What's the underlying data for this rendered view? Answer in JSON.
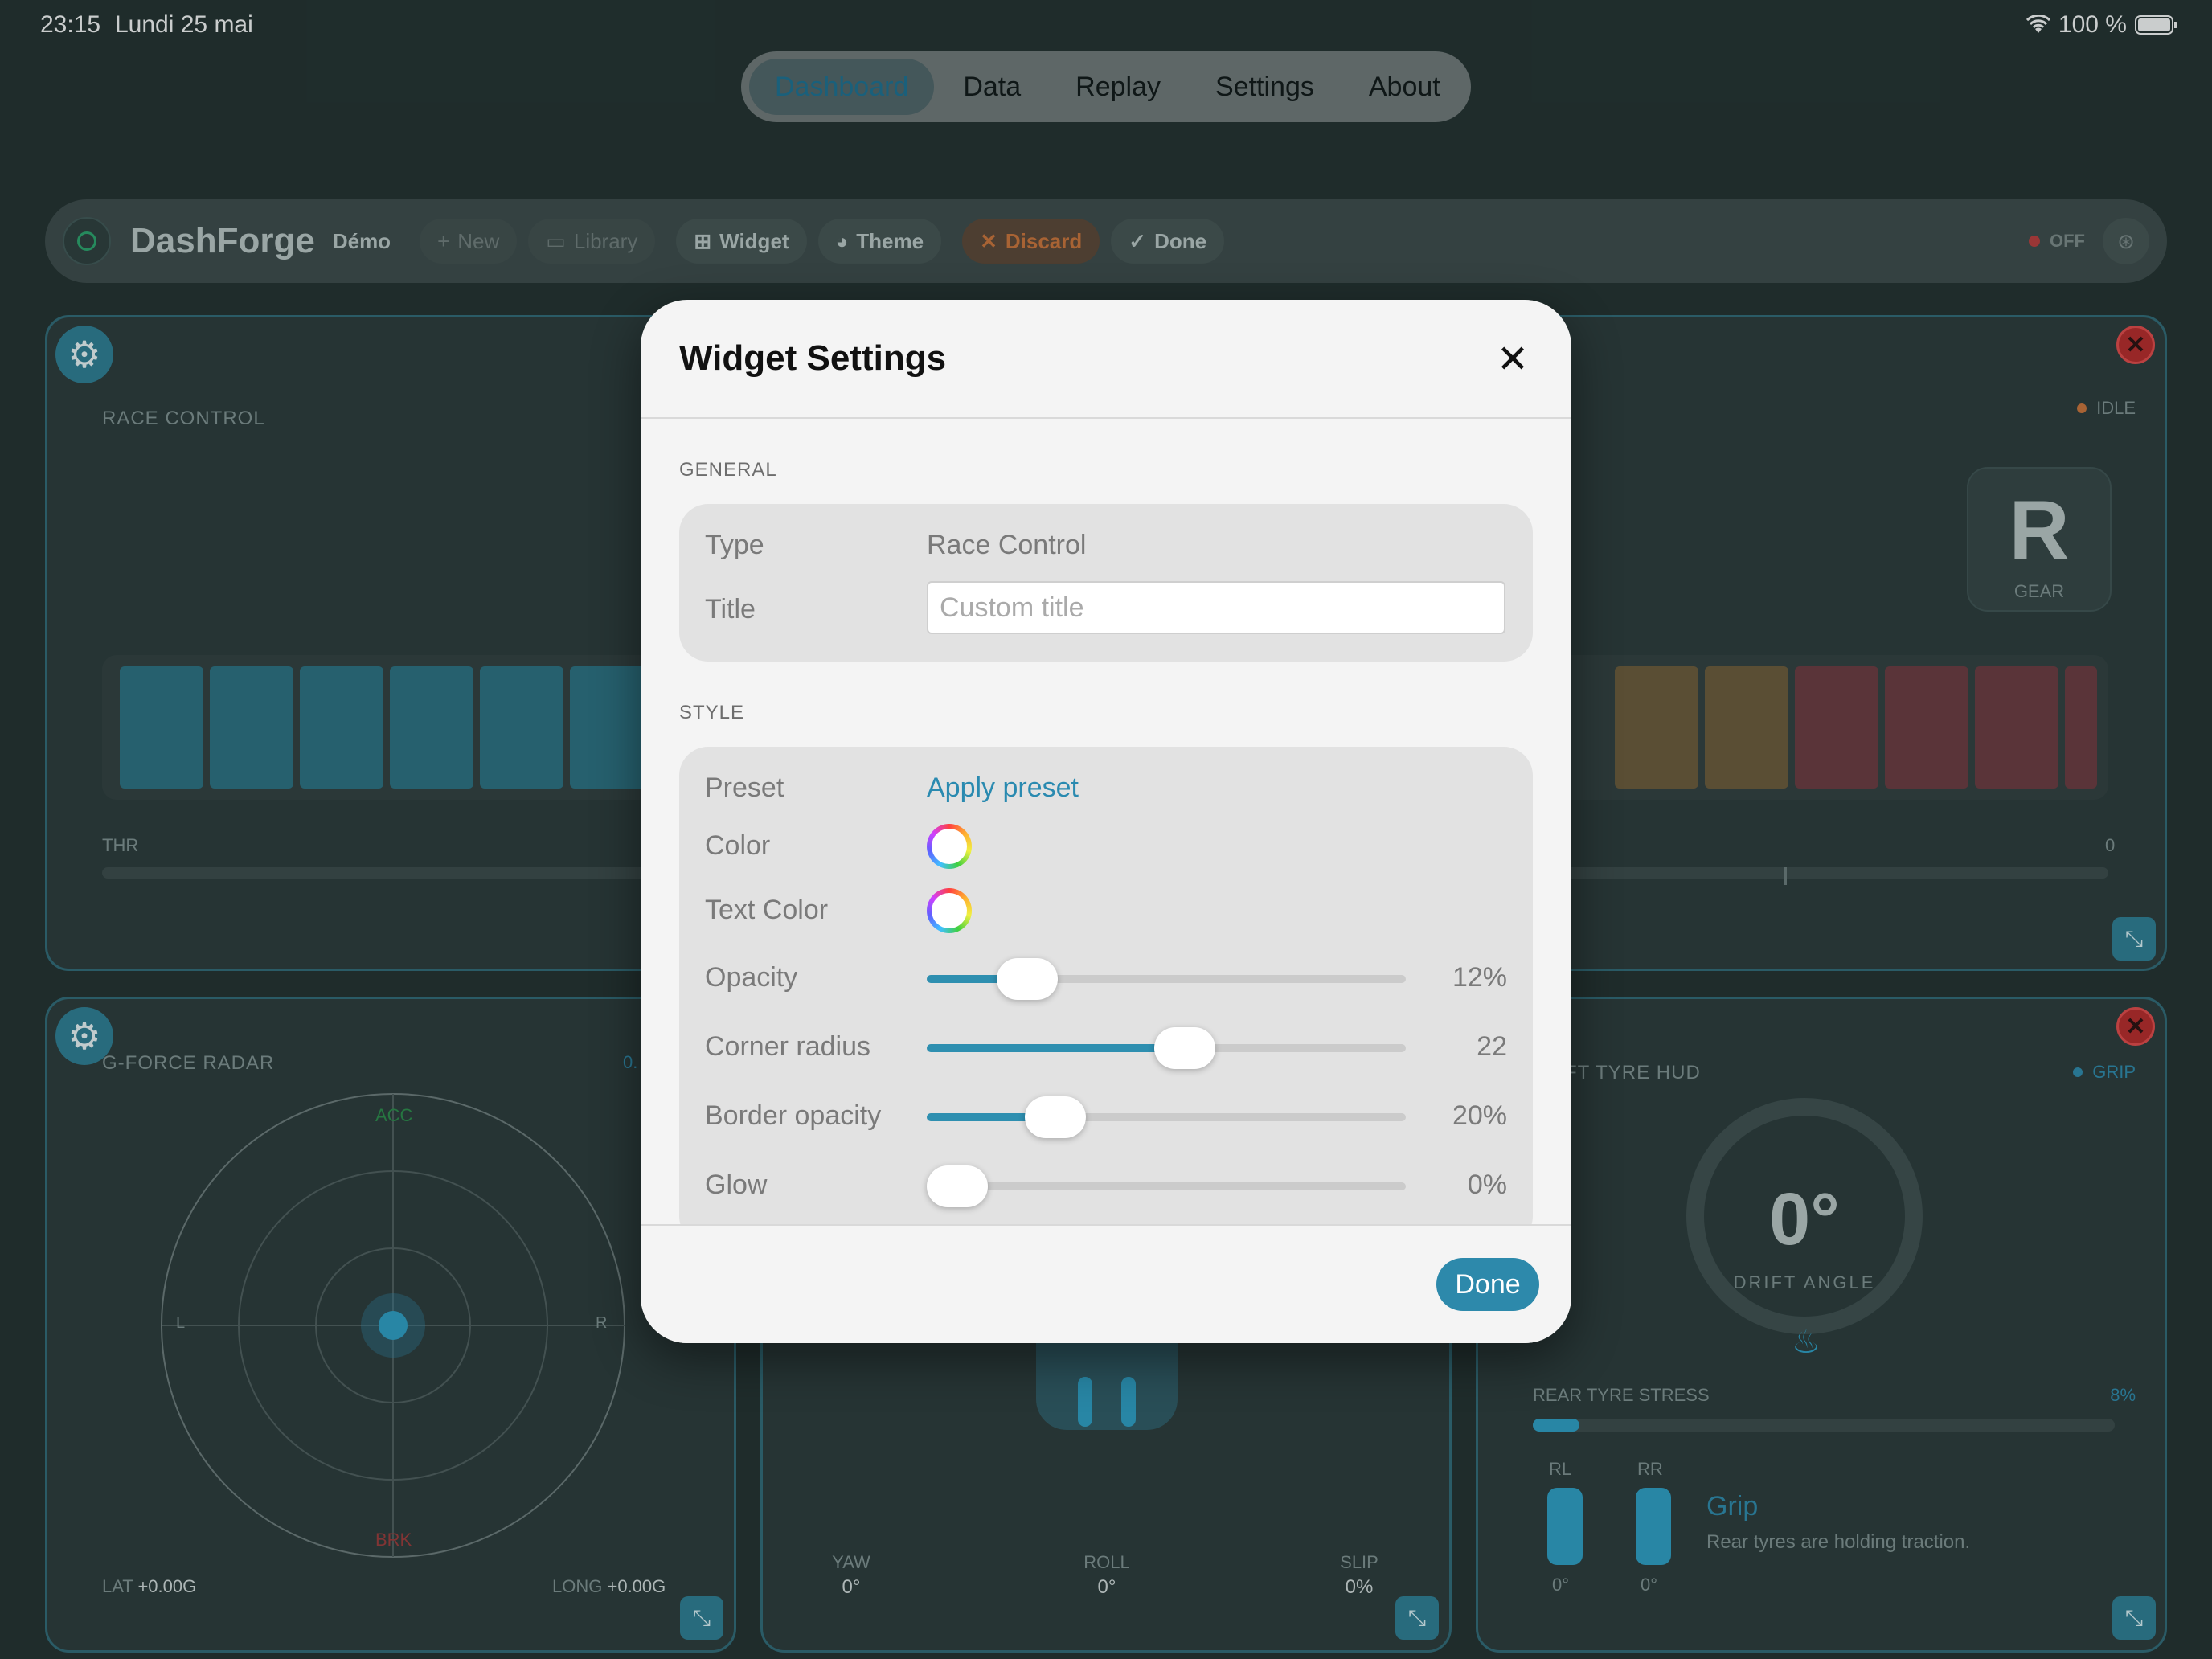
{
  "status": {
    "time": "23:15",
    "date": "Lundi 25 mai",
    "battery": "100 %"
  },
  "nav": {
    "tabs": [
      "Dashboard",
      "Data",
      "Replay",
      "Settings",
      "About"
    ],
    "active": "Dashboard"
  },
  "toolbar": {
    "app_name": "DashForge",
    "mode": "Démo",
    "new_label": "New",
    "library_label": "Library",
    "widget_label": "Widget",
    "theme_label": "Theme",
    "discard_label": "Discard",
    "done_label": "Done",
    "rec_status": "OFF"
  },
  "widgets": {
    "race_control": {
      "title": "RACE CONTROL",
      "throttle_label": "THR"
    },
    "gear": {
      "status": "IDLE",
      "gear": "R",
      "gear_label": "GEAR",
      "value": "0"
    },
    "gforce": {
      "title": "G-FORCE RADAR",
      "value_partial": "0.",
      "acc": "ACC",
      "brk": "BRK",
      "left": "L",
      "right": "R",
      "lat_label": "LAT",
      "lat_value": "+0.00G",
      "long_label": "LONG",
      "long_value": "+0.00G"
    },
    "car": {
      "yaw_label": "YAW",
      "yaw_value": "0°",
      "roll_label": "ROLL",
      "roll_value": "0°",
      "slip_label": "SLIP",
      "slip_value": "0%"
    },
    "drift": {
      "title_partial": "FT TYRE HUD",
      "status": "GRIP",
      "angle": "0°",
      "angle_label": "DRIFT ANGLE",
      "stress_label": "REAR TYRE STRESS",
      "stress_value": "8%",
      "stress_fraction": 0.08,
      "rl_label": "RL",
      "rl_value": "0°",
      "rr_label": "RR",
      "rr_value": "0°",
      "state_title": "Grip",
      "state_desc": "Rear tyres are holding traction."
    }
  },
  "modal": {
    "title": "Widget Settings",
    "general_label": "GENERAL",
    "type_label": "Type",
    "type_value": "Race Control",
    "title_label": "Title",
    "title_placeholder": "Custom title",
    "style_label": "STYLE",
    "preset_label": "Preset",
    "preset_action": "Apply preset",
    "color_label": "Color",
    "text_color_label": "Text Color",
    "sliders": [
      {
        "label": "Opacity",
        "value": "12%",
        "fraction": 0.167
      },
      {
        "label": "Corner radius",
        "value": "22",
        "fraction": 0.545
      },
      {
        "label": "Border opacity",
        "value": "20%",
        "fraction": 0.235
      },
      {
        "label": "Glow",
        "value": "0%",
        "fraction": 0.0
      }
    ],
    "done_label": "Done"
  },
  "colors": {
    "accent": "#2d89ab",
    "danger": "#b52a2a",
    "discard": "#c8733a"
  }
}
